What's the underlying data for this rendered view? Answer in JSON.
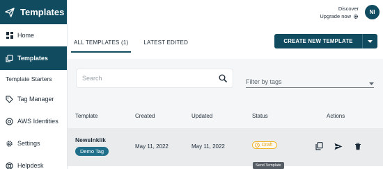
{
  "brand": {
    "name": "Templates"
  },
  "sidebar": {
    "items": [
      {
        "label": "Home"
      },
      {
        "label": "Templates"
      },
      {
        "label": "Template Starters"
      },
      {
        "label": "Tag Manager"
      },
      {
        "label": "AWS Identities"
      },
      {
        "label": "Settings"
      },
      {
        "label": "Helpdesk"
      }
    ]
  },
  "topbar": {
    "discover": "Discover",
    "upgrade": "Upgrade now",
    "avatar_initials": "NI"
  },
  "tabs": [
    {
      "label": "ALL TEMPLATES (1)"
    },
    {
      "label": "LATEST EDITED"
    }
  ],
  "create_button": {
    "label": "CREATE NEW TEMPLATE"
  },
  "search": {
    "placeholder": "Search"
  },
  "filter": {
    "placeholder": "Filter by tags"
  },
  "table": {
    "headers": {
      "template": "Template",
      "created": "Created",
      "updated": "Updated",
      "status": "Status",
      "actions": "Actions"
    },
    "rows": [
      {
        "name": "NewsInklik",
        "tag": "Demo Tag",
        "created": "May 11, 2022",
        "updated": "May 11, 2022",
        "status": "Draft"
      }
    ]
  },
  "tooltip": {
    "text": "Send Template"
  },
  "colors": {
    "primary": "#114b5f",
    "tag": "#1f6f8b",
    "draft": "#f0b429"
  }
}
